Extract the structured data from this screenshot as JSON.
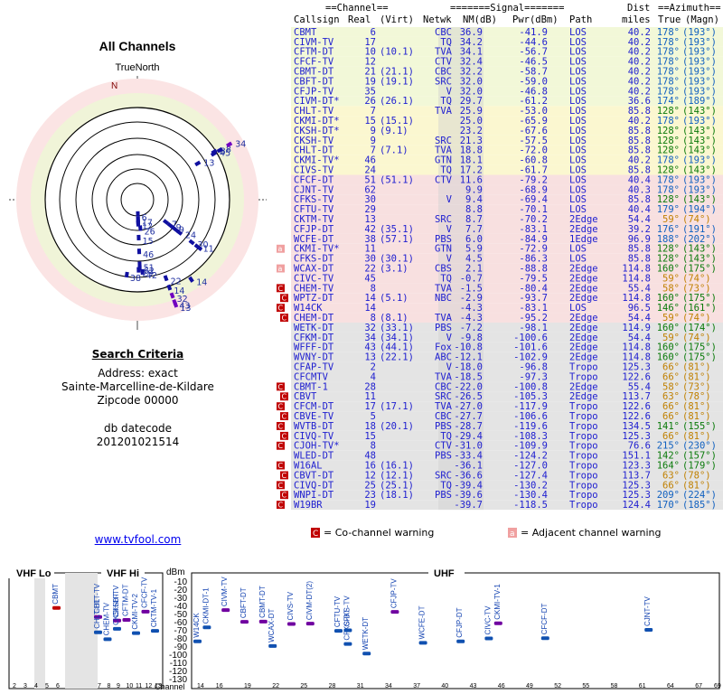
{
  "title": "All Channels",
  "truenorth_label": "TrueNorth",
  "magnetic_label": "N",
  "search": {
    "heading": "Search Criteria",
    "address": "Address: exact",
    "place": "Sainte-Marcelline-de-Kildare",
    "zip": "Zipcode 00000",
    "db_label": "db datecode",
    "db_value": "201201021514"
  },
  "link_text": "www.tvfool.com",
  "table_header": {
    "group_channel": "==Channel==",
    "group_signal": "=======Signal=======",
    "group_dist": "Dist",
    "group_azimuth": "==Azimuth==",
    "col_callsign": "Callsign",
    "col_real": "Real",
    "col_virt": "(Virt)",
    "col_netwk": "Netwk",
    "col_nm": "NM(dB)",
    "col_pwr": "Pwr(dBm)",
    "col_path": "Path",
    "col_miles": "miles",
    "col_true": "True",
    "col_magn": "(Magn)"
  },
  "legend": {
    "cochannel_mark": "C",
    "cochannel_text": "= Co-channel warning",
    "adjacent_mark": "a",
    "adjacent_text": "= Adjacent channel warning"
  },
  "colors": {
    "green": "#ffffcc",
    "yellow": "#f8f0c0",
    "red": "#f8e0e0",
    "gray": "#e0e0e0",
    "blue": "#2020d0",
    "azgreen": "#0a7a0a",
    "azorange": "#c08000",
    "azblue": "#1060c0",
    "purple": "#c000c0"
  },
  "chart_data": {
    "type": "table",
    "rows": [
      {
        "cs": "CBMT",
        "real": "6",
        "virt": "",
        "net": "CBC",
        "nm": "36.9",
        "pwr": "-41.9",
        "path": "LOS",
        "mi": "40.2",
        "az": "178°",
        "mag": "(193°)",
        "band": "green",
        "warn": ""
      },
      {
        "cs": "CIVM-TV",
        "real": "17",
        "virt": "",
        "net": "TQ",
        "nm": "34.2",
        "pwr": "-44.6",
        "path": "LOS",
        "mi": "40.2",
        "az": "178°",
        "mag": "(193°)",
        "band": "green",
        "warn": ""
      },
      {
        "cs": "CFTM-DT",
        "real": "10",
        "virt": "(10.1)",
        "net": "TVA",
        "nm": "34.1",
        "pwr": "-56.7",
        "path": "LOS",
        "mi": "40.2",
        "az": "178°",
        "mag": "(193°)",
        "band": "green",
        "warn": ""
      },
      {
        "cs": "CFCF-TV",
        "real": "12",
        "virt": "",
        "net": "CTV",
        "nm": "32.4",
        "pwr": "-46.5",
        "path": "LOS",
        "mi": "40.2",
        "az": "178°",
        "mag": "(193°)",
        "band": "green",
        "warn": ""
      },
      {
        "cs": "CBMT-DT",
        "real": "21",
        "virt": "(21.1)",
        "net": "CBC",
        "nm": "32.2",
        "pwr": "-58.7",
        "path": "LOS",
        "mi": "40.2",
        "az": "178°",
        "mag": "(193°)",
        "band": "green",
        "warn": ""
      },
      {
        "cs": "CBFT-DT",
        "real": "19",
        "virt": "(19.1)",
        "net": "SRC",
        "nm": "32.0",
        "pwr": "-59.0",
        "path": "LOS",
        "mi": "40.2",
        "az": "178°",
        "mag": "(193°)",
        "band": "green",
        "warn": ""
      },
      {
        "cs": "CFJP-TV",
        "real": "35",
        "virt": "",
        "net": "V",
        "nm": "32.0",
        "pwr": "-46.8",
        "path": "LOS",
        "mi": "40.2",
        "az": "178°",
        "mag": "(193°)",
        "band": "green",
        "warn": ""
      },
      {
        "cs": "CIVM-DT*",
        "real": "26",
        "virt": "(26.1)",
        "net": "TQ",
        "nm": "29.7",
        "pwr": "-61.2",
        "path": "LOS",
        "mi": "36.6",
        "az": "174°",
        "mag": "(189°)",
        "band": "green",
        "warn": ""
      },
      {
        "cs": "CHLT-TV",
        "real": "7",
        "virt": "",
        "net": "TVA",
        "nm": "25.9",
        "pwr": "-53.0",
        "path": "LOS",
        "mi": "85.8",
        "az": "128°",
        "mag": "(143°)",
        "band": "yellow",
        "warn": ""
      },
      {
        "cs": "CKMI-DT*",
        "real": "15",
        "virt": "(15.1)",
        "net": "",
        "nm": "25.0",
        "pwr": "-65.9",
        "path": "LOS",
        "mi": "40.2",
        "az": "178°",
        "mag": "(193°)",
        "band": "yellow",
        "warn": ""
      },
      {
        "cs": "CKSH-DT*",
        "real": "9",
        "virt": "(9.1)",
        "net": "",
        "nm": "23.2",
        "pwr": "-67.6",
        "path": "LOS",
        "mi": "85.8",
        "az": "128°",
        "mag": "(143°)",
        "band": "yellow",
        "warn": ""
      },
      {
        "cs": "CKSH-TV",
        "real": "9",
        "virt": "",
        "net": "SRC",
        "nm": "21.3",
        "pwr": "-57.5",
        "path": "LOS",
        "mi": "85.8",
        "az": "128°",
        "mag": "(143°)",
        "band": "yellow",
        "warn": ""
      },
      {
        "cs": "CHLT-DT",
        "real": "7",
        "virt": "(7.1)",
        "net": "TVA",
        "nm": "18.8",
        "pwr": "-72.0",
        "path": "LOS",
        "mi": "85.8",
        "az": "128°",
        "mag": "(143°)",
        "band": "yellow",
        "warn": ""
      },
      {
        "cs": "CKMI-TV*",
        "real": "46",
        "virt": "",
        "net": "GTN",
        "nm": "18.1",
        "pwr": "-60.8",
        "path": "LOS",
        "mi": "40.2",
        "az": "178°",
        "mag": "(193°)",
        "band": "yellow",
        "warn": ""
      },
      {
        "cs": "CIVS-TV",
        "real": "24",
        "virt": "",
        "net": "TQ",
        "nm": "17.2",
        "pwr": "-61.7",
        "path": "LOS",
        "mi": "85.8",
        "az": "128°",
        "mag": "(143°)",
        "band": "yellow",
        "warn": ""
      },
      {
        "cs": "CFCF-DT",
        "real": "51",
        "virt": "(51.1)",
        "net": "CTV",
        "nm": "11.6",
        "pwr": "-79.2",
        "path": "LOS",
        "mi": "40.4",
        "az": "178°",
        "mag": "(193°)",
        "band": "red",
        "warn": ""
      },
      {
        "cs": "CJNT-TV",
        "real": "62",
        "virt": "",
        "net": "",
        "nm": "9.9",
        "pwr": "-68.9",
        "path": "LOS",
        "mi": "40.3",
        "az": "178°",
        "mag": "(193°)",
        "band": "red",
        "warn": ""
      },
      {
        "cs": "CFKS-TV",
        "real": "30",
        "virt": "",
        "net": "V",
        "nm": "9.4",
        "pwr": "-69.4",
        "path": "LOS",
        "mi": "85.8",
        "az": "128°",
        "mag": "(143°)",
        "band": "red",
        "warn": ""
      },
      {
        "cs": "CFTU-TV",
        "real": "29",
        "virt": "",
        "net": "",
        "nm": "8.8",
        "pwr": "-70.1",
        "path": "LOS",
        "mi": "40.4",
        "az": "179°",
        "mag": "(194°)",
        "band": "red",
        "warn": ""
      },
      {
        "cs": "CKTM-TV",
        "real": "13",
        "virt": "",
        "net": "SRC",
        "nm": "8.7",
        "pwr": "-70.2",
        "path": "2Edge",
        "mi": "54.4",
        "az": "59°",
        "mag": "(74°)",
        "band": "red",
        "warn": ""
      },
      {
        "cs": "CFJP-DT",
        "real": "42",
        "virt": "(35.1)",
        "net": "V",
        "nm": "7.7",
        "pwr": "-83.1",
        "path": "2Edge",
        "mi": "39.2",
        "az": "176°",
        "mag": "(191°)",
        "band": "red",
        "warn": ""
      },
      {
        "cs": "WCFE-DT",
        "real": "38",
        "virt": "(57.1)",
        "net": "PBS",
        "nm": "6.0",
        "pwr": "-84.9",
        "path": "1Edge",
        "mi": "96.9",
        "az": "188°",
        "mag": "(202°)",
        "band": "red",
        "warn": ""
      },
      {
        "cs": "CKMI-TV*",
        "real": "11",
        "virt": "",
        "net": "GTN",
        "nm": "5.9",
        "pwr": "-72.9",
        "path": "LOS",
        "mi": "85.8",
        "az": "128°",
        "mag": "(143°)",
        "band": "red",
        "warn": "a"
      },
      {
        "cs": "CFKS-DT",
        "real": "30",
        "virt": "(30.1)",
        "net": "V",
        "nm": "4.5",
        "pwr": "-86.3",
        "path": "LOS",
        "mi": "85.8",
        "az": "128°",
        "mag": "(143°)",
        "band": "red",
        "warn": ""
      },
      {
        "cs": "WCAX-DT",
        "real": "22",
        "virt": "(3.1)",
        "net": "CBS",
        "nm": "2.1",
        "pwr": "-88.8",
        "path": "2Edge",
        "mi": "114.8",
        "az": "160°",
        "mag": "(175°)",
        "band": "red",
        "warn": "a"
      },
      {
        "cs": "CIVC-TV",
        "real": "45",
        "virt": "",
        "net": "TQ",
        "nm": "-0.7",
        "pwr": "-79.5",
        "path": "2Edge",
        "mi": "114.8",
        "az": "59°",
        "mag": "(74°)",
        "band": "red",
        "warn": ""
      },
      {
        "cs": "CHEM-TV",
        "real": "8",
        "virt": "",
        "net": "TVA",
        "nm": "-1.5",
        "pwr": "-80.4",
        "path": "2Edge",
        "mi": "55.4",
        "az": "58°",
        "mag": "(73°)",
        "band": "red",
        "warn": "C"
      },
      {
        "cs": "WPTZ-DT",
        "real": "14",
        "virt": "(5.1)",
        "net": "NBC",
        "nm": "-2.9",
        "pwr": "-93.7",
        "path": "2Edge",
        "mi": "114.8",
        "az": "160°",
        "mag": "(175°)",
        "band": "red",
        "warn": "C"
      },
      {
        "cs": "W14CK",
        "real": "14",
        "virt": "",
        "net": "",
        "nm": "-4.3",
        "pwr": "-83.1",
        "path": "LOS",
        "mi": "96.5",
        "az": "146°",
        "mag": "(161°)",
        "band": "red",
        "warn": "C"
      },
      {
        "cs": "CHEM-DT",
        "real": "8",
        "virt": "(8.1)",
        "net": "TVA",
        "nm": "-4.3",
        "pwr": "-95.2",
        "path": "2Edge",
        "mi": "54.4",
        "az": "59°",
        "mag": "(74°)",
        "band": "red",
        "warn": "C"
      },
      {
        "cs": "WETK-DT",
        "real": "32",
        "virt": "(33.1)",
        "net": "PBS",
        "nm": "-7.2",
        "pwr": "-98.1",
        "path": "2Edge",
        "mi": "114.9",
        "az": "160°",
        "mag": "(174°)",
        "band": "gray",
        "warn": ""
      },
      {
        "cs": "CFKM-DT",
        "real": "34",
        "virt": "(34.1)",
        "net": "V",
        "nm": "-9.8",
        "pwr": "-100.6",
        "path": "2Edge",
        "mi": "54.4",
        "az": "59°",
        "mag": "(74°)",
        "band": "gray",
        "warn": ""
      },
      {
        "cs": "WFFF-DT",
        "real": "43",
        "virt": "(44.1)",
        "net": "Fox",
        "nm": "-10.8",
        "pwr": "-101.6",
        "path": "2Edge",
        "mi": "114.8",
        "az": "160°",
        "mag": "(175°)",
        "band": "gray",
        "warn": ""
      },
      {
        "cs": "WVNY-DT",
        "real": "13",
        "virt": "(22.1)",
        "net": "ABC",
        "nm": "-12.1",
        "pwr": "-102.9",
        "path": "2Edge",
        "mi": "114.8",
        "az": "160°",
        "mag": "(175°)",
        "band": "gray",
        "warn": ""
      },
      {
        "cs": "CFAP-TV",
        "real": "2",
        "virt": "",
        "net": "V",
        "nm": "-18.0",
        "pwr": "-96.8",
        "path": "Tropo",
        "mi": "125.3",
        "az": "66°",
        "mag": "(81°)",
        "band": "gray",
        "warn": ""
      },
      {
        "cs": "CFCMTV",
        "real": "4",
        "virt": "",
        "net": "TVA",
        "nm": "-18.5",
        "pwr": "-97.3",
        "path": "Tropo",
        "mi": "122.6",
        "az": "66°",
        "mag": "(81°)",
        "band": "gray",
        "warn": ""
      },
      {
        "cs": "CBMT-1",
        "real": "28",
        "virt": "",
        "net": "CBC",
        "nm": "-22.0",
        "pwr": "-100.8",
        "path": "2Edge",
        "mi": "55.4",
        "az": "58°",
        "mag": "(73°)",
        "band": "gray",
        "warn": "C"
      },
      {
        "cs": "CBVT",
        "real": "11",
        "virt": "",
        "net": "SRC",
        "nm": "-26.5",
        "pwr": "-105.3",
        "path": "2Edge",
        "mi": "113.7",
        "az": "63°",
        "mag": "(78°)",
        "band": "gray",
        "warn": "C"
      },
      {
        "cs": "CFCM-DT",
        "real": "17",
        "virt": "(17.1)",
        "net": "TVA",
        "nm": "-27.0",
        "pwr": "-117.9",
        "path": "Tropo",
        "mi": "122.6",
        "az": "66°",
        "mag": "(81°)",
        "band": "gray",
        "warn": "C"
      },
      {
        "cs": "CBVE-TV",
        "real": "5",
        "virt": "",
        "net": "CBC",
        "nm": "-27.7",
        "pwr": "-106.6",
        "path": "Tropo",
        "mi": "122.6",
        "az": "66°",
        "mag": "(81°)",
        "band": "gray",
        "warn": "C"
      },
      {
        "cs": "WVTB-DT",
        "real": "18",
        "virt": "(20.1)",
        "net": "PBS",
        "nm": "-28.7",
        "pwr": "-119.6",
        "path": "Tropo",
        "mi": "134.5",
        "az": "141°",
        "mag": "(155°)",
        "band": "gray",
        "warn": "C"
      },
      {
        "cs": "CIVQ-TV",
        "real": "15",
        "virt": "",
        "net": "TQ",
        "nm": "-29.4",
        "pwr": "-108.3",
        "path": "Tropo",
        "mi": "125.3",
        "az": "66°",
        "mag": "(81°)",
        "band": "gray",
        "warn": "C"
      },
      {
        "cs": "CJOH-TV*",
        "real": "8",
        "virt": "",
        "net": "CTV",
        "nm": "-31.0",
        "pwr": "-109.9",
        "path": "Tropo",
        "mi": "76.6",
        "az": "215°",
        "mag": "(230°)",
        "band": "gray",
        "warn": "C"
      },
      {
        "cs": "WLED-DT",
        "real": "48",
        "virt": "",
        "net": "PBS",
        "nm": "-33.4",
        "pwr": "-124.2",
        "path": "Tropo",
        "mi": "151.1",
        "az": "142°",
        "mag": "(157°)",
        "band": "gray",
        "warn": ""
      },
      {
        "cs": "W16AL",
        "real": "16",
        "virt": "(16.1)",
        "net": "",
        "nm": "-36.1",
        "pwr": "-127.0",
        "path": "Tropo",
        "mi": "123.3",
        "az": "164°",
        "mag": "(179°)",
        "band": "gray",
        "warn": "C"
      },
      {
        "cs": "CBVT-DT",
        "real": "12",
        "virt": "(12.1)",
        "net": "SRC",
        "nm": "-36.6",
        "pwr": "-127.4",
        "path": "Tropo",
        "mi": "113.7",
        "az": "63°",
        "mag": "(78°)",
        "band": "gray",
        "warn": "C"
      },
      {
        "cs": "CIVQ-DT",
        "real": "25",
        "virt": "(25.1)",
        "net": "TQ",
        "nm": "-39.4",
        "pwr": "-130.2",
        "path": "Tropo",
        "mi": "125.3",
        "az": "66°",
        "mag": "(81°)",
        "band": "gray",
        "warn": "C"
      },
      {
        "cs": "WNPI-DT",
        "real": "23",
        "virt": "(18.1)",
        "net": "PBS",
        "nm": "-39.6",
        "pwr": "-130.4",
        "path": "Tropo",
        "mi": "125.3",
        "az": "209°",
        "mag": "(224°)",
        "band": "gray",
        "warn": "C"
      },
      {
        "cs": "W19BR",
        "real": "19",
        "virt": "",
        "net": "",
        "nm": "-39.7",
        "pwr": "-118.5",
        "path": "Tropo",
        "mi": "124.4",
        "az": "170°",
        "mag": "(185°)",
        "band": "gray",
        "warn": "C"
      }
    ],
    "spectrum": {
      "vhf_lo_label": "VHF Lo",
      "vhf_hi_label": "VHF Hi",
      "uhf_label": "UHF",
      "ylabel": "dBm",
      "yticks": [
        "-10",
        "-20",
        "-30",
        "-40",
        "-50",
        "-60",
        "-70",
        "-80",
        "-90",
        "-100",
        "-110",
        "-120",
        "-130"
      ],
      "ylim": [
        -130,
        -10
      ],
      "channel_label": "Channel",
      "vhf_lo_ticks": [
        "2",
        "3",
        "4",
        "5",
        "6"
      ],
      "vhf_hi_ticks": [
        "7",
        "8",
        "9",
        "10",
        "11",
        "12",
        "13"
      ],
      "uhf_ticks": [
        "14",
        "16",
        "19",
        "22",
        "25",
        "28",
        "31",
        "34",
        "37",
        "40",
        "43",
        "46",
        "49",
        "52",
        "55",
        "58",
        "61",
        "64",
        "67",
        "69"
      ],
      "points": [
        {
          "label": "CBMT",
          "ch": 6,
          "dbm": -41.9,
          "color": "#c00000"
        },
        {
          "label": "CHLT-TV",
          "ch": 7,
          "dbm": -53.0
        },
        {
          "label": "CHLT-DT",
          "ch": 7,
          "dbm": -72.0
        },
        {
          "label": "CHEM-TV",
          "ch": 8,
          "dbm": -80.4
        },
        {
          "label": "CKSH-TV",
          "ch": 9,
          "dbm": -57.5
        },
        {
          "label": "CKSH-DT",
          "ch": 9,
          "dbm": -67.6
        },
        {
          "label": "CFTM-DT",
          "ch": 10,
          "dbm": -56.7
        },
        {
          "label": "CKMI-TV-2",
          "ch": 11,
          "dbm": -72.9
        },
        {
          "label": "CFCF-TV",
          "ch": 12,
          "dbm": -46.5
        },
        {
          "label": "CKTM-TV-1",
          "ch": 13,
          "dbm": -70.2
        },
        {
          "label": "W14CK",
          "ch": 14,
          "dbm": -83.1
        },
        {
          "label": "CKMI-DT-1",
          "ch": 15,
          "dbm": -65.9
        },
        {
          "label": "CIVM-TV",
          "ch": 17,
          "dbm": -44.6
        },
        {
          "label": "CBFT-DT",
          "ch": 19,
          "dbm": -59.0
        },
        {
          "label": "CBMT-DT",
          "ch": 21,
          "dbm": -58.7
        },
        {
          "label": "WCAX-DT",
          "ch": 22,
          "dbm": -88.8
        },
        {
          "label": "CIVS-TV",
          "ch": 24,
          "dbm": -61.7
        },
        {
          "label": "CIVM-DT(2)",
          "ch": 26,
          "dbm": -61.2
        },
        {
          "label": "CFTU-TV",
          "ch": 29,
          "dbm": -70.1
        },
        {
          "label": "CFKS-DT",
          "ch": 30,
          "dbm": -86.3
        },
        {
          "label": "CFKS-TV",
          "ch": 30,
          "dbm": -69.4
        },
        {
          "label": "WETK-DT",
          "ch": 32,
          "dbm": -98.1
        },
        {
          "label": "CFJP-TV",
          "ch": 35,
          "dbm": -46.8
        },
        {
          "label": "WCFE-DT",
          "ch": 38,
          "dbm": -84.9
        },
        {
          "label": "CFJP-DT",
          "ch": 42,
          "dbm": -83.1
        },
        {
          "label": "CIVC-TV",
          "ch": 45,
          "dbm": -79.5
        },
        {
          "label": "CKMI-TV-1",
          "ch": 46,
          "dbm": -60.8
        },
        {
          "label": "CFCF-DT",
          "ch": 51,
          "dbm": -79.2
        },
        {
          "label": "CJNT-TV",
          "ch": 62,
          "dbm": -68.9
        }
      ]
    },
    "polar": {
      "labels": [
        "6",
        "17",
        "10",
        "12",
        "21",
        "26",
        "19",
        "35",
        "38",
        "22",
        "14",
        "32",
        "43",
        "15",
        "36",
        "2",
        "13",
        "45",
        "8",
        "4",
        "7",
        "9",
        "24",
        "30",
        "14"
      ]
    }
  }
}
